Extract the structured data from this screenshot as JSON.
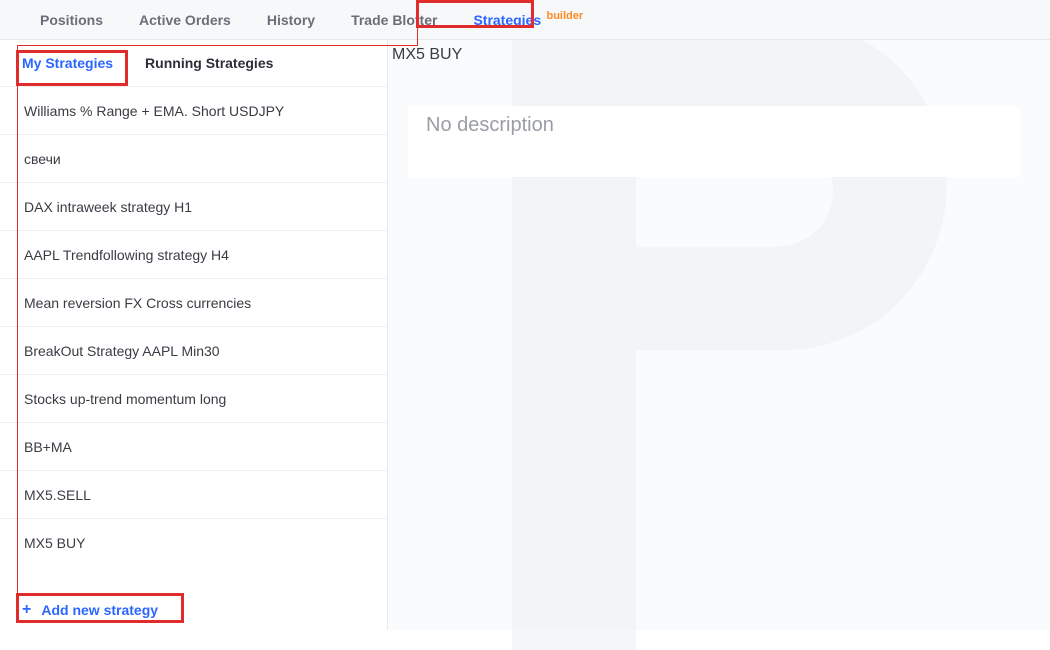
{
  "top_tabs": {
    "positions": "Positions",
    "active_orders": "Active Orders",
    "history": "History",
    "trade_blotter": "Trade Blotter",
    "strategies": "Strategies",
    "strategies_badge": "builder"
  },
  "sub_tabs": {
    "my_strategies": "My Strategies",
    "running_strategies": "Running Strategies"
  },
  "strategies": [
    "Williams % Range + EMA. Short USDJPY",
    "свечи",
    "DAX intraweek strategy H1",
    "AAPL Trendfollowing strategy H4",
    "Mean reversion FX Cross currencies",
    "BreakOut Strategy AAPL Min30",
    "Stocks up-trend momentum long",
    "BB+MA",
    "MX5.SELL",
    "MX5 BUY"
  ],
  "add_new_label": "Add new strategy",
  "detail": {
    "title": "MX5 BUY",
    "description": "No description"
  },
  "colors": {
    "accent": "#2b66ff",
    "highlight": "#e12c2c",
    "badge": "#ff8a1f"
  }
}
